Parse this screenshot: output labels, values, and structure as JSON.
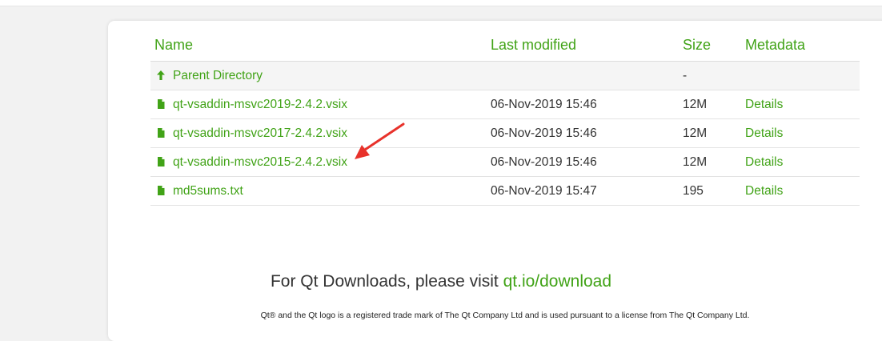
{
  "table": {
    "headers": {
      "name": "Name",
      "last_modified": "Last modified",
      "size": "Size",
      "metadata": "Metadata"
    },
    "rows": [
      {
        "icon": "up-arrow-icon",
        "name": "Parent Directory",
        "modified": "",
        "size": "-",
        "meta": ""
      },
      {
        "icon": "file-icon",
        "name": "qt-vsaddin-msvc2019-2.4.2.vsix",
        "modified": "06-Nov-2019 15:46",
        "size": "12M",
        "meta": "Details"
      },
      {
        "icon": "file-icon",
        "name": "qt-vsaddin-msvc2017-2.4.2.vsix",
        "modified": "06-Nov-2019 15:46",
        "size": "12M",
        "meta": "Details"
      },
      {
        "icon": "file-icon",
        "name": "qt-vsaddin-msvc2015-2.4.2.vsix",
        "modified": "06-Nov-2019 15:46",
        "size": "12M",
        "meta": "Details"
      },
      {
        "icon": "file-icon",
        "name": "md5sums.txt",
        "modified": "06-Nov-2019 15:47",
        "size": "195",
        "meta": "Details"
      }
    ]
  },
  "footer": {
    "prefix": "For Qt Downloads, please visit ",
    "link": "qt.io/download",
    "legal": "Qt® and the Qt logo is a registered trade mark of The Qt Company Ltd and is used pursuant to a license from The Qt Company Ltd."
  },
  "colors": {
    "accent": "#41a317",
    "annotation_arrow": "#e8322b"
  }
}
